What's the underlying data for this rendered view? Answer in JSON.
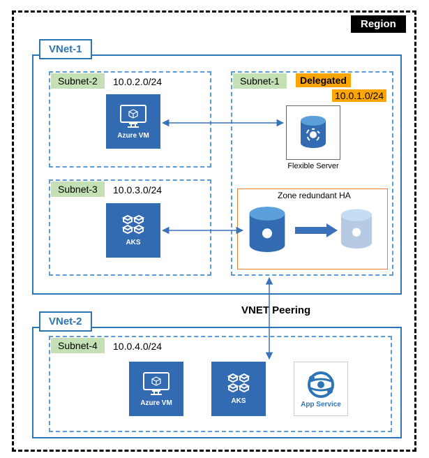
{
  "region": {
    "label": "Region"
  },
  "vnet1": {
    "label": "VNet-1",
    "subnet2": {
      "label": "Subnet-2",
      "cidr": "10.0.2.0/24",
      "vm_label": "Azure VM"
    },
    "subnet3": {
      "label": "Subnet-3",
      "cidr": "10.0.3.0/24",
      "aks_label": "AKS"
    },
    "subnet1": {
      "label": "Subnet-1",
      "delegated": "Delegated",
      "cidr": "10.0.1.0/24",
      "flexible_label": "Flexible Server",
      "ha_label": "Zone redundant HA"
    }
  },
  "peering_label": "VNET Peering",
  "vnet2": {
    "label": "VNet-2",
    "subnet4": {
      "label": "Subnet-4",
      "cidr": "10.0.4.0/24",
      "vm_label": "Azure VM",
      "aks_label": "AKS",
      "appservice_label": "App Service"
    }
  }
}
